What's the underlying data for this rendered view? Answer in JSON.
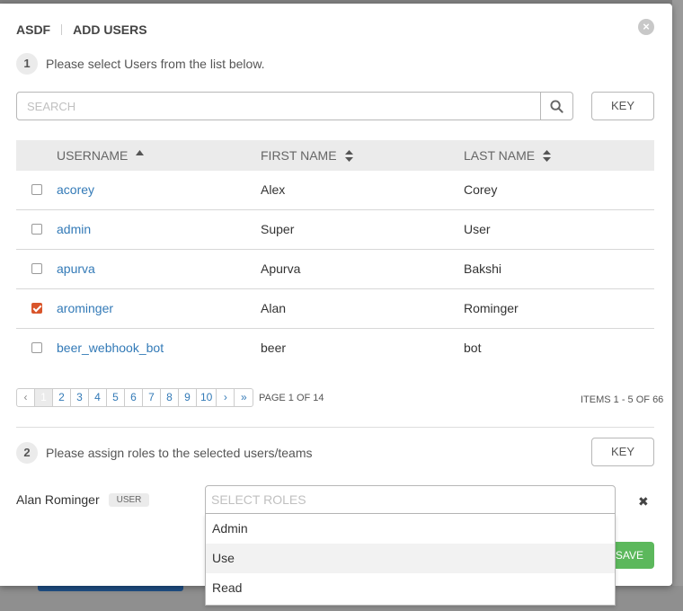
{
  "header": {
    "org": "ASDF",
    "title": "ADD USERS"
  },
  "step1": {
    "number": "1",
    "text": "Please select Users from the list below."
  },
  "search": {
    "placeholder": "SEARCH"
  },
  "key_label": "KEY",
  "table": {
    "columns": [
      "USERNAME",
      "FIRST NAME",
      "LAST NAME"
    ],
    "rows": [
      {
        "username": "acorey",
        "first": "Alex",
        "last": "Corey",
        "checked": false
      },
      {
        "username": "admin",
        "first": "Super",
        "last": "User",
        "checked": false
      },
      {
        "username": "apurva",
        "first": "Apurva",
        "last": "Bakshi",
        "checked": false
      },
      {
        "username": "arominger",
        "first": "Alan",
        "last": "Rominger",
        "checked": true
      },
      {
        "username": "beer_webhook_bot",
        "first": "beer",
        "last": "bot",
        "checked": false
      }
    ]
  },
  "pagination": {
    "prev": "‹",
    "pages": [
      "1",
      "2",
      "3",
      "4",
      "5",
      "6",
      "7",
      "8",
      "9",
      "10"
    ],
    "next": "›",
    "last": "»",
    "page_of": "PAGE 1 OF 14",
    "items": "ITEMS  1 - 5 OF 66"
  },
  "step2": {
    "number": "2",
    "text": "Please assign roles to the selected users/teams"
  },
  "assign": {
    "user_name": "Alan Rominger",
    "badge": "USER",
    "roles_placeholder": "SELECT ROLES",
    "remove": "✖"
  },
  "dropdown": {
    "options": [
      "Admin",
      "Use",
      "Read"
    ]
  },
  "save_label": "SAVE",
  "close_symbol": "×",
  "colors": {
    "link": "#337ab7",
    "checked": "#d9552b",
    "save": "#5cb85c"
  }
}
